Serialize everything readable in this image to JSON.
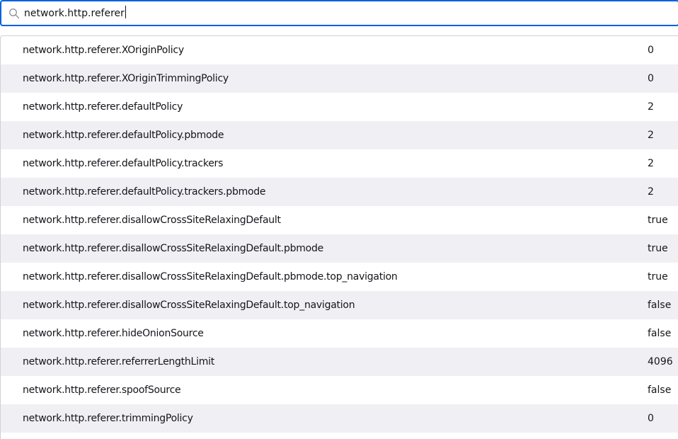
{
  "search": {
    "value": "network.http.referer"
  },
  "prefs": [
    {
      "name": "network.http.referer.XOriginPolicy",
      "value": "0"
    },
    {
      "name": "network.http.referer.XOriginTrimmingPolicy",
      "value": "0"
    },
    {
      "name": "network.http.referer.defaultPolicy",
      "value": "2"
    },
    {
      "name": "network.http.referer.defaultPolicy.pbmode",
      "value": "2"
    },
    {
      "name": "network.http.referer.defaultPolicy.trackers",
      "value": "2"
    },
    {
      "name": "network.http.referer.defaultPolicy.trackers.pbmode",
      "value": "2"
    },
    {
      "name": "network.http.referer.disallowCrossSiteRelaxingDefault",
      "value": "true"
    },
    {
      "name": "network.http.referer.disallowCrossSiteRelaxingDefault.pbmode",
      "value": "true"
    },
    {
      "name": "network.http.referer.disallowCrossSiteRelaxingDefault.pbmode.top_navigation",
      "value": "true"
    },
    {
      "name": "network.http.referer.disallowCrossSiteRelaxingDefault.top_navigation",
      "value": "false"
    },
    {
      "name": "network.http.referer.hideOnionSource",
      "value": "false"
    },
    {
      "name": "network.http.referer.referrerLengthLimit",
      "value": "4096"
    },
    {
      "name": "network.http.referer.spoofSource",
      "value": "false"
    },
    {
      "name": "network.http.referer.trimmingPolicy",
      "value": "0"
    }
  ]
}
